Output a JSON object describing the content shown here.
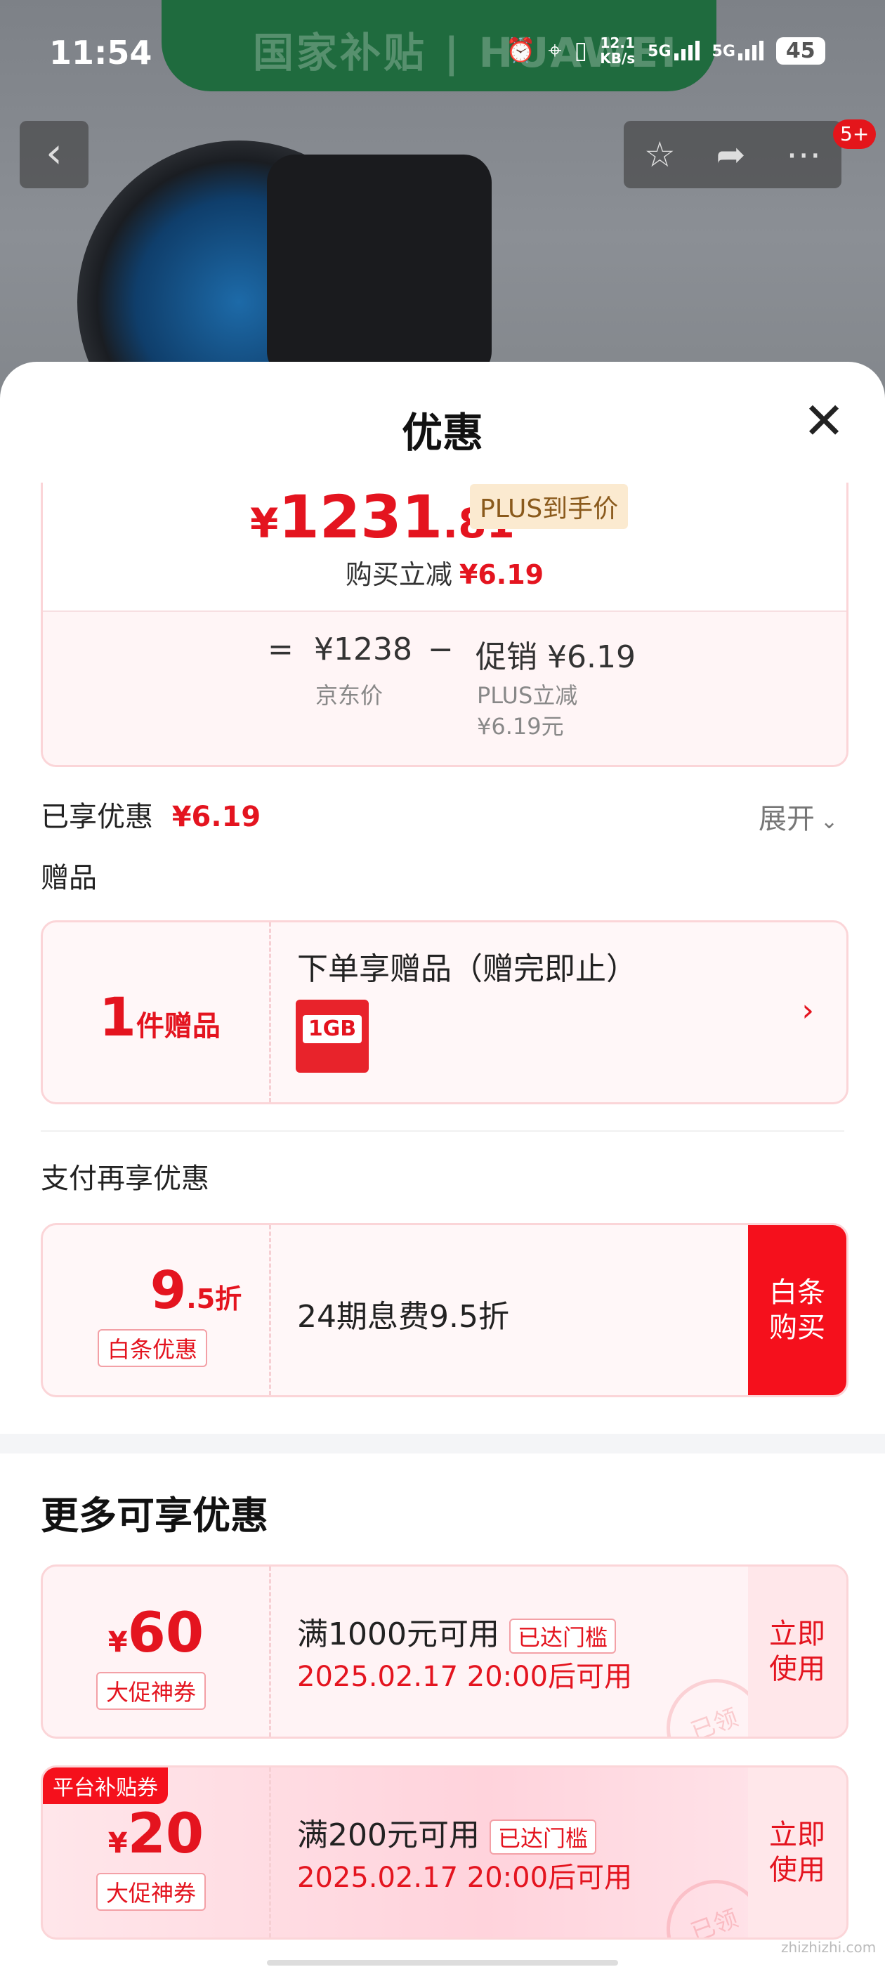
{
  "status_bar": {
    "time": "11:54",
    "net_speed_value": "12.1",
    "net_speed_unit": "KB/s",
    "sim1": "5G",
    "sim2": "5G",
    "battery": "45"
  },
  "banner": {
    "text": "国家补贴 | HUAWEI"
  },
  "top_bar": {
    "more_badge": "5+"
  },
  "sheet": {
    "title": "优惠"
  },
  "price": {
    "yen": "¥",
    "integer": "1231",
    "decimal": ".81",
    "plus_tag": "PLUS到手价",
    "buy_reduce_label": "购买立减",
    "buy_reduce_value": "¥6.19",
    "eq": "=",
    "jd_price_value": "¥1238",
    "jd_price_label": "京东价",
    "minus": "−",
    "promo_label": "促销",
    "promo_value": "¥6.19",
    "plus_reduce_label": "PLUS立减",
    "plus_reduce_value": "¥6.19元"
  },
  "enjoyed": {
    "label": "已享优惠",
    "value": "¥6.19",
    "expand": "展开"
  },
  "gift": {
    "section": "赠品",
    "count": "1",
    "unit": "件赠品",
    "title": "下单享赠品（赠完即止）",
    "img_label": "1GB"
  },
  "pay": {
    "section": "支付再享优惠",
    "discount_int": "9",
    "discount_unit": ".5折",
    "tag": "白条优惠",
    "desc": "24期息费9.5折",
    "button": "白条购买"
  },
  "more": {
    "title": "更多可享优惠",
    "coupons": [
      {
        "yen": "¥",
        "amount": "60",
        "tag": "大促神券",
        "condition": "满1000元可用",
        "reached": "已达门槛",
        "time": "2025.02.17 20:00后可用",
        "button": "立即使用",
        "stamp": "已领"
      },
      {
        "platform_tag": "平台补贴券",
        "yen": "¥",
        "amount": "20",
        "tag": "大促神券",
        "condition": "满200元可用",
        "reached": "已达门槛",
        "time": "2025.02.17 20:00后可用",
        "button": "立即使用",
        "stamp": "已领"
      }
    ]
  },
  "watermark": "zhizhizhi.com"
}
